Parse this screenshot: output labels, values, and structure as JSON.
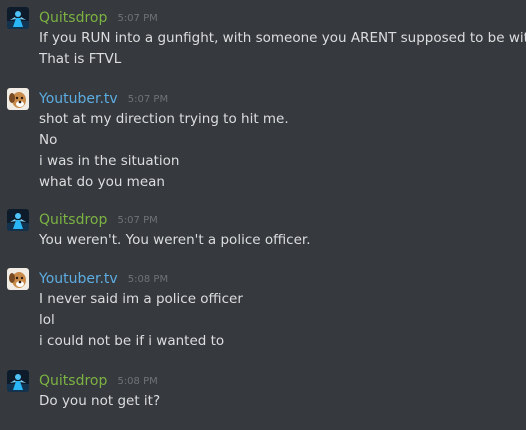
{
  "colors": {
    "background": "#36393e",
    "username_quitsdrop": "#7cb342",
    "username_youtuber": "#5dade2",
    "message_text": "#dcddde",
    "timestamp": "#6f7377"
  },
  "messages": [
    {
      "author": "Quitsdrop",
      "avatar_icon": "blue-figure-avatar-icon",
      "time": "5:07 PM",
      "lines": [
        "If you RUN into a gunfight, with someone you ARENT supposed to be with",
        "That is FTVL"
      ]
    },
    {
      "author": "Youtuber.tv",
      "avatar_icon": "dog-avatar-icon",
      "time": "5:07 PM",
      "lines": [
        "shot at my direction trying to hit me.",
        "No",
        "i was in the situation",
        "what do you mean"
      ]
    },
    {
      "author": "Quitsdrop",
      "avatar_icon": "blue-figure-avatar-icon",
      "time": "5:07 PM",
      "lines": [
        "You weren't. You weren't a police officer."
      ]
    },
    {
      "author": "Youtuber.tv",
      "avatar_icon": "dog-avatar-icon",
      "time": "5:08 PM",
      "lines": [
        "I never said im a police officer",
        "lol",
        "i could not be if i wanted to"
      ]
    },
    {
      "author": "Quitsdrop",
      "avatar_icon": "blue-figure-avatar-icon",
      "time": "5:08 PM",
      "lines": [
        "Do you not get it?"
      ]
    }
  ]
}
